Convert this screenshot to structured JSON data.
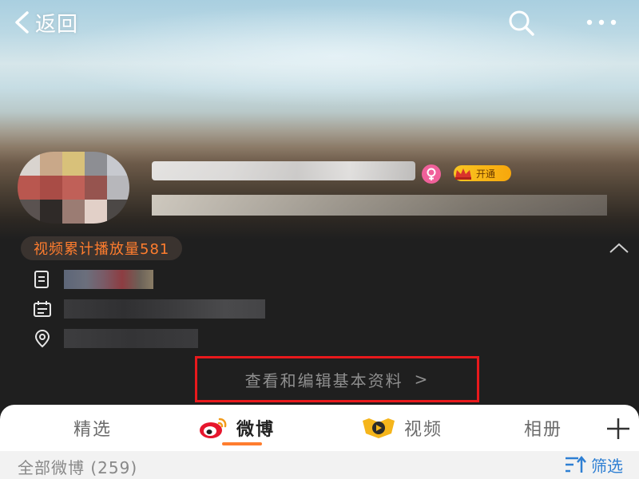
{
  "header": {
    "back_label": "返回",
    "back_icon": "chevron-left-icon",
    "search_icon": "search-icon",
    "more_icon": "more-dots-icon"
  },
  "profile": {
    "vip_label": "开通",
    "views_label": "视频累计播放量581",
    "edit_profile_label": "查看和编辑基本资料",
    "edit_profile_arrow": ">"
  },
  "tabs": [
    {
      "label": "精选",
      "active": false
    },
    {
      "label": "微博",
      "active": true,
      "icon": "weibo-logo-icon"
    },
    {
      "label": "视频",
      "active": false,
      "icon": "video-badge-icon"
    },
    {
      "label": "相册",
      "active": false
    }
  ],
  "feed": {
    "title": "全部微博 (259)",
    "filter_label": "筛选",
    "filter_icon": "filter-sort-icon"
  },
  "colors": {
    "accent_orange": "#ff7d2e",
    "highlight_box": "#e8191c",
    "link_blue": "#2e7fd3"
  }
}
